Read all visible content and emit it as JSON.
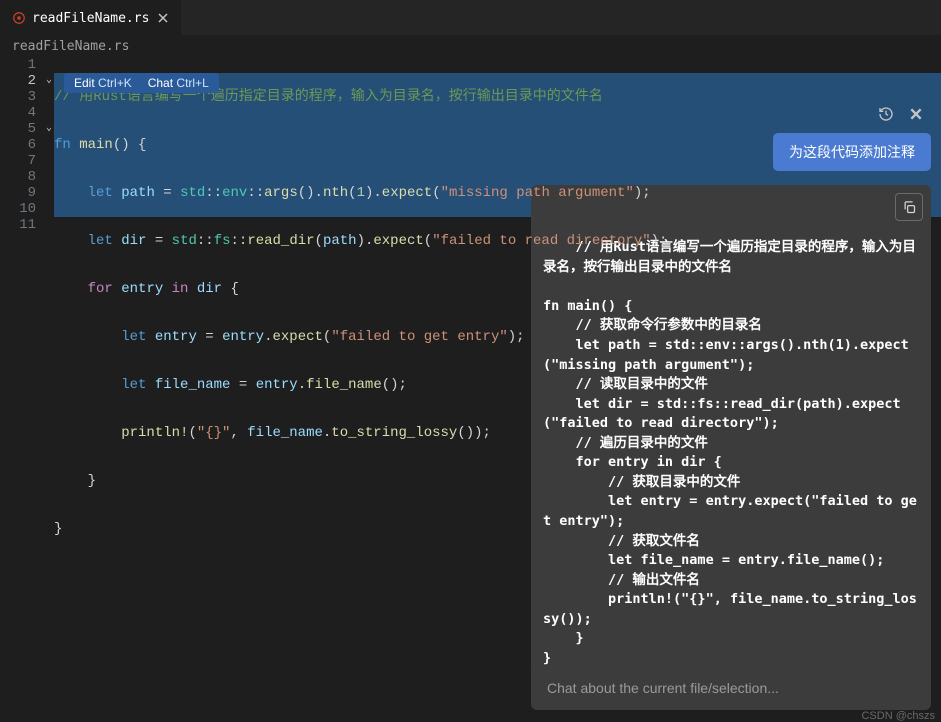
{
  "tab": {
    "title": "readFileName.rs",
    "icon": "rust-icon"
  },
  "breadcrumb": "readFileName.rs",
  "inline_toolbar": {
    "edit_label": "Edit",
    "edit_kbd": "Ctrl+K",
    "chat_label": "Chat",
    "chat_kbd": "Ctrl+L"
  },
  "code": {
    "line1_comment": "// 用Rust语言编写一个遍历指定目录的程序，输入为目录名，按行输出目录中的文件名",
    "line2": {
      "fn": "fn",
      "main": "main",
      "paren": "() {"
    },
    "line3": {
      "let": "let",
      "path": "path",
      "eq": " = ",
      "std": "std",
      "env": "env",
      "args": "args",
      "nth": "nth",
      "one": "1",
      "expect": "expect",
      "s": "\"missing path argument\""
    },
    "line4": {
      "let": "let",
      "dir": "dir",
      "eq": " = ",
      "std": "std",
      "fs": "fs",
      "read_dir": "read_dir",
      "path": "path",
      "expect": "expect",
      "s": "\"failed to read directory\""
    },
    "line5": {
      "for": "for",
      "entry": "entry",
      "in": "in",
      "dir": "dir",
      "brace": "{"
    },
    "line6": {
      "let": "let",
      "entry": "entry",
      "eq": " = ",
      "entry2": "entry",
      "expect": "expect",
      "s": "\"failed to get entry\""
    },
    "line7": {
      "let": "let",
      "fname": "file_name",
      "eq": " = ",
      "entry": "entry",
      "fn": "file_name"
    },
    "line8": {
      "println": "println!",
      "fmt": "\"{}\"",
      "fname": "file_name",
      "tsl": "to_string_lossy"
    },
    "line9": "}",
    "line10": "}",
    "total_lines": 11
  },
  "ai": {
    "action_button": "为这段代码添加注释",
    "code_block": "// 用Rust语言编写一个遍历指定目录的程序，输入为目录名，按行输出目录中的文件名\n\nfn main() {\n    // 获取命令行参数中的目录名\n    let path = std::env::args().nth(1).expect(\"missing path argument\");\n    // 读取目录中的文件\n    let dir = std::fs::read_dir(path).expect(\"failed to read directory\");\n    // 遍历目录中的文件\n    for entry in dir {\n        // 获取目录中的文件\n        let entry = entry.expect(\"failed to get entry\");\n        // 获取文件名\n        let file_name = entry.file_name();\n        // 输出文件名\n        println!(\"{}\", file_name.to_string_lossy());\n    }\n}"
  },
  "chat": {
    "placeholder": "Chat about the current file/selection..."
  },
  "watermark": "CSDN @chszs"
}
